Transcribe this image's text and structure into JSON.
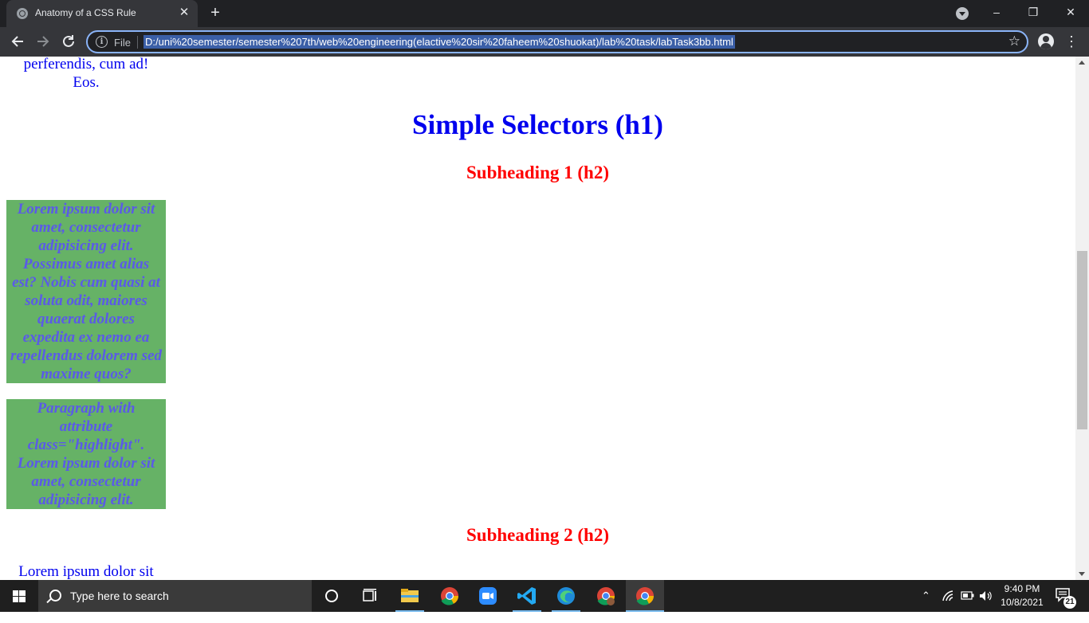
{
  "browser": {
    "tab_title": "Anatomy of a CSS Rule",
    "tab_close": "✕",
    "new_tab": "+",
    "file_label": "File",
    "url": "D:/uni%20semester/semester%207th/web%20engineering(elactive%20sir%20faheem%20shuokat)/lab%20task/labTask3bb.html",
    "window_controls": [
      "–",
      "❐",
      "✕"
    ]
  },
  "page": {
    "top_paragraph_tail": [
      "perferendis, cum ad!",
      "Eos."
    ],
    "h1": "Simple Selectors (h1)",
    "subheading1": "Subheading 1 (h2)",
    "box1_lines": [
      "Lorem ipsum dolor sit",
      "amet, consectetur",
      "adipisicing elit.",
      "Possimus amet alias",
      "est? Nobis cum quasi at",
      "soluta odit, maiores",
      "quaerat dolores",
      "expedita ex nemo ea",
      "repellendus dolorem sed",
      "maxime quos?"
    ],
    "box2_lines": [
      "Paragraph with",
      "attribute",
      "class=\"highlight\".",
      "Lorem ipsum dolor sit",
      "amet, consectetur",
      "adipisicing elit."
    ],
    "subheading2": "Subheading 2 (h2)",
    "bottom_paragraph_start": "Lorem ipsum dolor sit"
  },
  "taskbar": {
    "search_placeholder": "Type here to search",
    "time": "9:40 PM",
    "date": "10/8/2021",
    "notification_count": "21",
    "apps": [
      "cortana-icon",
      "task-view-icon",
      "file-explorer-icon",
      "chrome-icon",
      "zoom-icon",
      "vscode-icon",
      "edge-icon",
      "chrome-profile-icon",
      "chrome-active-icon"
    ]
  },
  "colors": {
    "heading_blue": "#0000ee",
    "subheading_red": "#ff0000",
    "highlight_green": "#66b266",
    "highlight_text": "#5a5ae8"
  }
}
